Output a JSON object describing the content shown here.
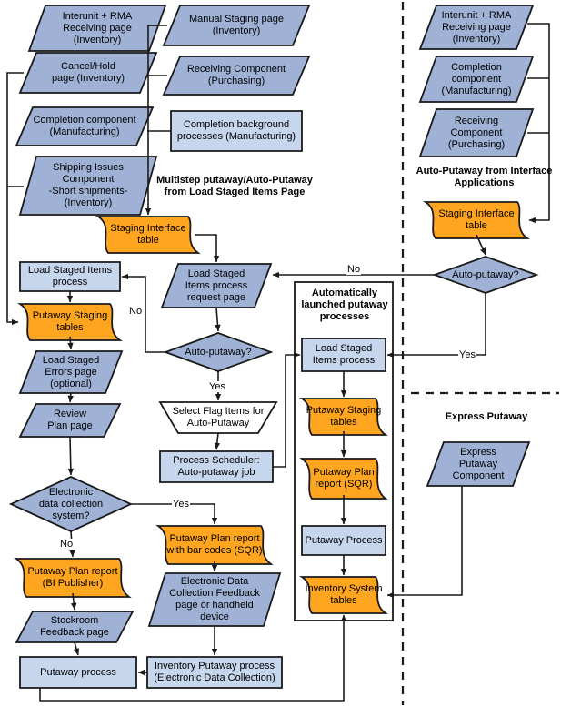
{
  "colors": {
    "slate_blue": "#9fb2d6",
    "light_blue": "#c6d6ec",
    "orange": "#ffa51f",
    "white": "#ffffff",
    "stroke": "#1a1a1a"
  },
  "section_titles": {
    "multistep": "Multistep putaway/Auto-Putaway\nfrom Load Staged Items Page",
    "auto_interface": "Auto-Putaway from Interface\nApplications",
    "express": "Express Putaway",
    "auto_launched": "Automatically\nlaunched\nputaway processes"
  },
  "nodes": {
    "n_interunit_left": {
      "label": "Interunit + RMA\nReceiving page\n(Inventory)"
    },
    "n_cancel_hold": {
      "label": "Cancel/Hold\npage (Inventory)"
    },
    "n_completion_comp": {
      "label": "Completion component\n(Manufacturing)"
    },
    "n_shipping_issues": {
      "label": "Shipping Issues\nComponent\n-Short shipments-\n(Inventory)"
    },
    "n_manual_staging": {
      "label": "Manual Staging page\n(Inventory)"
    },
    "n_receiving_comp": {
      "label": "Receiving Component\n(Purchasing)"
    },
    "n_completion_bg": {
      "label": "Completion background\nprocesses (Manufacturing)"
    },
    "n_staging_if_left": {
      "label": "Staging Interface\ntable"
    },
    "n_load_staged_left": {
      "label": "Load Staged Items\nprocess"
    },
    "n_putaway_staging_left": {
      "label": "Putaway Staging\ntables"
    },
    "n_load_errors": {
      "label": "Load Staged\nErrors page\n(optional)"
    },
    "n_review_plan": {
      "label": "Review\nPlan page"
    },
    "n_edc_decision": {
      "label": "Electronic\ndata collection\nsystem?"
    },
    "n_plan_bi": {
      "label": "Putaway Plan report\n(BI Publisher)"
    },
    "n_stockroom": {
      "label": "Stockroom\nFeedback page"
    },
    "n_putaway_process_b": {
      "label": "Putaway process"
    },
    "n_request_page": {
      "label": "Load Staged\nItems process\nrequest page"
    },
    "n_auto_mid": {
      "label": "Auto-putaway?"
    },
    "n_select_flag": {
      "label": "Select Flag Items for\nAuto-Putaway"
    },
    "n_proc_sched": {
      "label": "Process Scheduler:\nAuto-putaway job"
    },
    "n_plan_barcodes": {
      "label": "Putaway Plan report\nwith bar codes (SQR)"
    },
    "n_edc_feedback": {
      "label": "Electronic Data\nCollection Feedback\npage or handheld\ndevice"
    },
    "n_inv_putaway": {
      "label": "Inventory Putaway process\n(Electronic Data Collection)"
    },
    "n_load_staged_mid": {
      "label": "Load Staged\nItems process"
    },
    "n_putaway_staging_mid": {
      "label": "Putaway Staging\ntables"
    },
    "n_plan_sqr": {
      "label": "Putaway Plan\nreport (SQR)"
    },
    "n_putaway_proc_mid": {
      "label": "Putaway Process"
    },
    "n_inventory_system": {
      "label": "Inventory System\ntables"
    },
    "n_interunit_right": {
      "label": "Interunit + RMA\nReceiving page\n(Inventory)"
    },
    "n_completion_right": {
      "label": "Completion\ncomponent\n(Manufacturing)"
    },
    "n_receiving_right": {
      "label": "Receiving\nComponent\n(Purchasing)"
    },
    "n_staging_if_right": {
      "label": "Staging Interface\ntable"
    },
    "n_auto_right": {
      "label": "Auto-putaway?"
    },
    "n_express_comp": {
      "label": "Express\nPutaway\nComponent"
    }
  },
  "edge_labels": {
    "no_mid": "No",
    "yes_mid": "Yes",
    "no_right": "No",
    "yes_right": "Yes",
    "yes_edc": "Yes",
    "no_edc": "No"
  }
}
